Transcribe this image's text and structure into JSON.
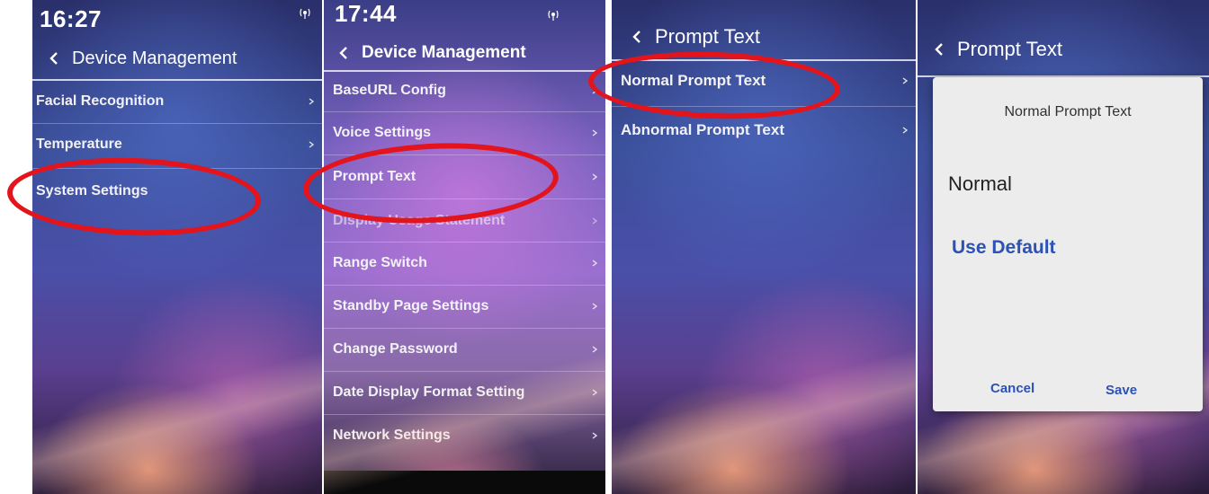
{
  "screen1": {
    "time": "16:27",
    "header": "Device Management",
    "items": [
      {
        "label": "Facial Recognition"
      },
      {
        "label": "Temperature"
      },
      {
        "label": "System Settings"
      }
    ]
  },
  "screen2": {
    "time": "17:44",
    "header": "Device Management",
    "items": [
      {
        "label": "BaseURL Config"
      },
      {
        "label": "Voice Settings"
      },
      {
        "label": "Prompt Text"
      },
      {
        "label": "Display Usage Statement"
      },
      {
        "label": "Range Switch"
      },
      {
        "label": "Standby Page Settings"
      },
      {
        "label": "Change Password"
      },
      {
        "label": "Date Display Format Setting"
      },
      {
        "label": "Network Settings"
      }
    ]
  },
  "screen3": {
    "header": "Prompt Text",
    "items": [
      {
        "label": "Normal Prompt Text"
      },
      {
        "label": "Abnormal Prompt Text"
      }
    ]
  },
  "screen4": {
    "header": "Prompt Text",
    "dialog": {
      "title": "Normal Prompt Text",
      "value": "Normal",
      "use_default": "Use Default",
      "cancel": "Cancel",
      "save": "Save"
    }
  },
  "colors": {
    "highlight_circle": "#e3141b",
    "dialog_action": "#2c52b5"
  },
  "icons": [
    "back-chevron-icon",
    "chevron-right-icon",
    "signal-antenna-icon"
  ]
}
